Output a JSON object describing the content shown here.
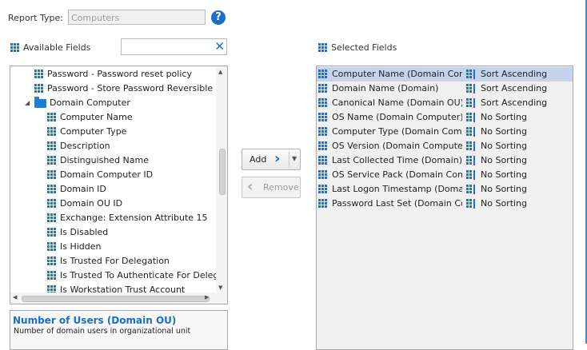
{
  "report": {
    "label": "Report Type:",
    "value": "Computers"
  },
  "available": {
    "header": "Available Fields",
    "search_placeholder": "",
    "items": [
      {
        "label": "Password - Password reset policy",
        "level": 1,
        "type": "field"
      },
      {
        "label": "Password - Store Password Reversible Encryption",
        "level": 1,
        "type": "field"
      },
      {
        "label": "Domain Computer",
        "level": 1,
        "type": "folder"
      },
      {
        "label": "Computer Name",
        "level": 2,
        "type": "field"
      },
      {
        "label": "Computer Type",
        "level": 2,
        "type": "field"
      },
      {
        "label": "Description",
        "level": 2,
        "type": "field"
      },
      {
        "label": "Distinguished Name",
        "level": 2,
        "type": "field"
      },
      {
        "label": "Domain Computer ID",
        "level": 2,
        "type": "field"
      },
      {
        "label": "Domain ID",
        "level": 2,
        "type": "field"
      },
      {
        "label": "Domain OU ID",
        "level": 2,
        "type": "field"
      },
      {
        "label": "Exchange: Extension Attribute 15",
        "level": 2,
        "type": "field"
      },
      {
        "label": "Is Disabled",
        "level": 2,
        "type": "field"
      },
      {
        "label": "Is Hidden",
        "level": 2,
        "type": "field"
      },
      {
        "label": "Is Trusted For Delegation",
        "level": 2,
        "type": "field"
      },
      {
        "label": "Is Trusted To Authenticate For Delegation",
        "level": 2,
        "type": "field"
      },
      {
        "label": "Is Workstation Trust Account",
        "level": 2,
        "type": "field"
      }
    ]
  },
  "description": {
    "title": "Number of Users (Domain OU)",
    "text": "Number of domain users in organizational unit"
  },
  "buttons": {
    "add": "Add",
    "remove": "Remove"
  },
  "selected": {
    "header": "Selected Fields",
    "rows": [
      {
        "field": "Computer Name (Domain Computer)",
        "sort": "Sort Ascending",
        "selected": true
      },
      {
        "field": "Domain Name (Domain)",
        "sort": "Sort Ascending",
        "selected": false
      },
      {
        "field": "Canonical Name (Domain OU)",
        "sort": "Sort Ascending",
        "selected": false
      },
      {
        "field": "OS Name (Domain Computer)",
        "sort": "No Sorting",
        "selected": false
      },
      {
        "field": "Computer Type (Domain Computer)",
        "sort": "No Sorting",
        "selected": false
      },
      {
        "field": "OS Version (Domain Computer)",
        "sort": "No Sorting",
        "selected": false
      },
      {
        "field": "Last Collected Time (Domain)",
        "sort": "No Sorting",
        "selected": false
      },
      {
        "field": "OS Service Pack (Domain Computer)",
        "sort": "No Sorting",
        "selected": false
      },
      {
        "field": "Last Logon Timestamp (Domain Computer)",
        "sort": "No Sorting",
        "selected": false
      },
      {
        "field": "Password Last Set (Domain Computer)",
        "sort": "No Sorting",
        "selected": false
      }
    ]
  }
}
